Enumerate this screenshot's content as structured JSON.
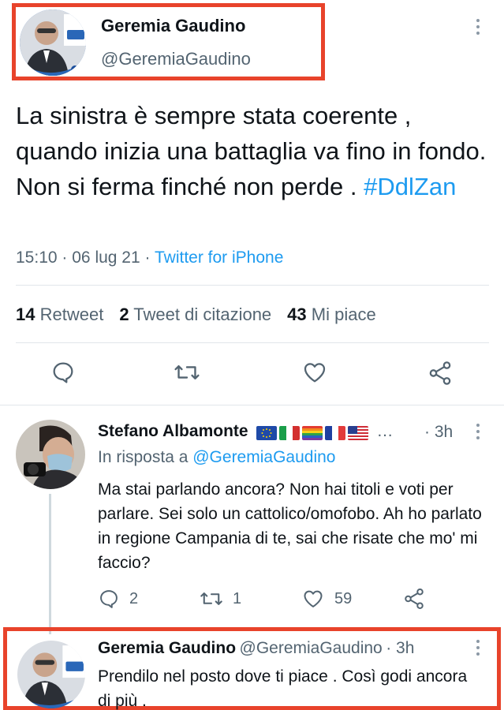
{
  "main_tweet": {
    "author_name": "Geremia Gaudino",
    "author_handle": "@GeremiaGaudino",
    "text": "La sinistra è sempre stata coerente , quando inizia una battaglia va fino in fondo. Non si ferma finché non perde . ",
    "hashtag": "#DdlZan",
    "time": "15:10",
    "date": "06 lug 21",
    "source": "Twitter for iPhone",
    "separator": "·",
    "stats": {
      "retweets_count": "14",
      "retweets_label": "Retweet",
      "quotes_count": "2",
      "quotes_label": "Tweet di citazione",
      "likes_count": "43",
      "likes_label": "Mi piace"
    }
  },
  "reply_1": {
    "author_name": "Stefano Albamonte",
    "flags": [
      "eu-flag",
      "italy-flag",
      "rainbow-flag",
      "france-flag",
      "usa-flag"
    ],
    "ellipsis": "…",
    "time": "· 3h",
    "reply_to_prefix": "In risposta a ",
    "reply_to_handle": "@GeremiaGaudino",
    "text": "Ma stai parlando ancora? Non hai titoli e voti per parlare. Sei solo un cattolico/omofobo. Ah ho parlato in regione Campania di te, sai che risate che mo' mi faccio?",
    "replies": "2",
    "retweets": "1",
    "likes": "59"
  },
  "reply_2": {
    "author_name": "Geremia Gaudino",
    "author_handle": "@GeremiaGaudino",
    "time": "· 3h",
    "text": "Prendilo nel posto dove ti piace . Così godi ancora di più ."
  },
  "colors": {
    "highlight_border": "#e8432b",
    "link_blue": "#1d9bf0",
    "secondary_text": "#536471"
  }
}
